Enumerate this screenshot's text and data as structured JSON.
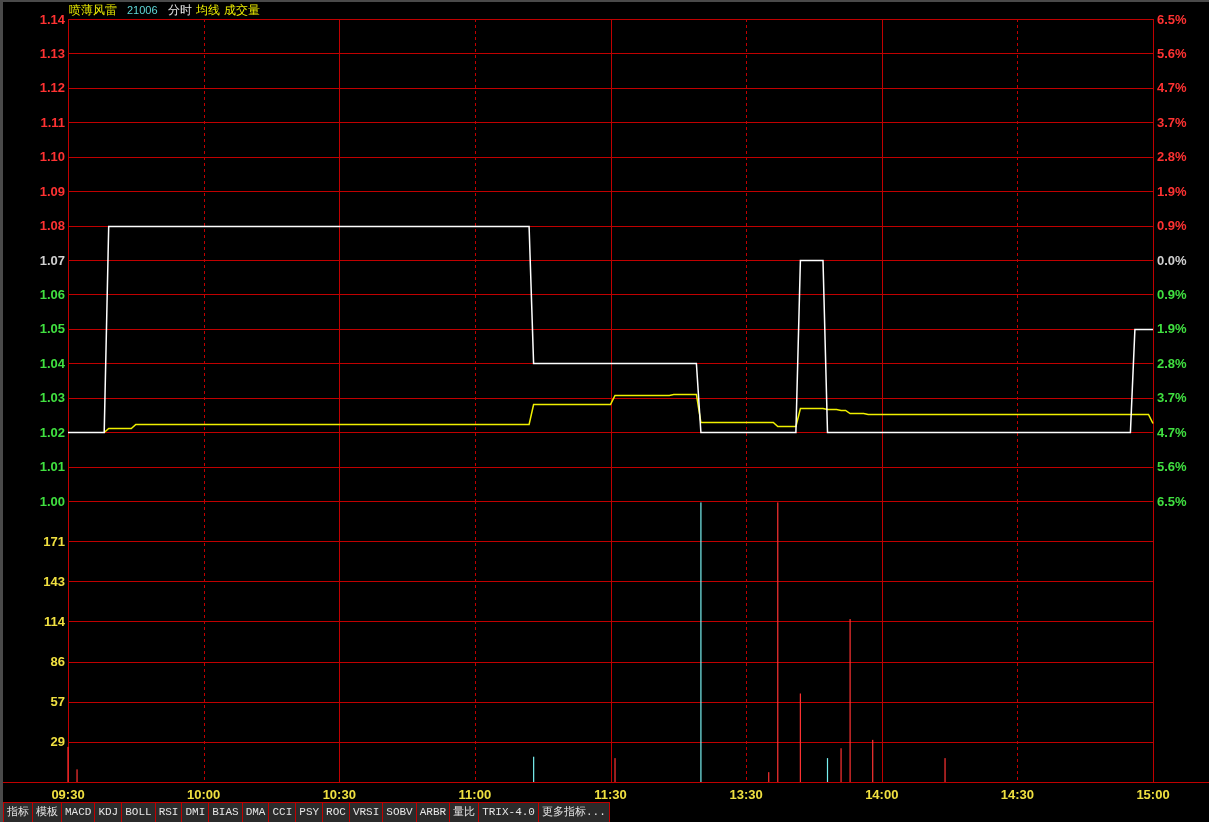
{
  "header": {
    "title": "喷薄风雷",
    "code": "21006",
    "items": [
      {
        "label": "分时",
        "kind": "mode"
      },
      {
        "label": "均线",
        "kind": "indicator"
      },
      {
        "label": "成交量",
        "kind": "indicator"
      }
    ]
  },
  "price_chart": {
    "chart_data": {
      "type": "line",
      "grid": true,
      "categories": [
        null,
        null,
        null,
        null,
        null,
        null,
        null,
        null,
        null,
        null,
        null,
        null,
        null,
        null,
        null,
        null,
        null,
        null,
        null,
        null,
        null,
        null,
        null,
        null,
        null,
        null,
        null,
        null,
        null,
        null,
        null,
        null,
        null,
        null,
        null,
        null,
        null,
        null,
        null,
        null,
        null,
        null,
        null,
        null,
        null,
        null,
        null,
        null,
        null,
        null,
        null,
        null,
        null,
        null,
        null,
        null,
        null,
        null,
        null,
        null,
        null,
        null,
        null,
        null,
        null,
        null,
        null,
        null,
        null,
        null,
        null,
        null,
        null,
        null,
        null,
        null,
        null,
        null,
        null,
        null,
        null,
        null,
        null,
        null,
        null,
        null,
        null,
        null,
        null,
        null,
        null,
        null,
        null,
        null,
        null,
        null,
        null,
        null,
        null,
        null,
        null,
        null,
        null,
        null,
        null,
        null,
        null,
        null,
        null,
        null,
        null,
        null,
        null,
        null,
        null,
        null,
        null,
        null,
        null,
        null,
        null,
        null,
        null,
        null,
        null,
        null,
        null,
        null,
        null,
        null,
        null,
        null,
        null,
        null,
        null,
        null,
        null,
        null,
        null,
        null,
        null,
        null,
        null,
        null,
        null,
        null,
        null,
        null,
        null,
        null,
        null,
        null,
        null,
        null,
        null,
        null,
        null,
        null,
        null,
        null,
        null,
        null,
        null,
        null,
        null,
        null,
        null,
        null,
        null,
        null,
        null,
        null,
        null,
        null,
        null,
        null,
        null,
        null,
        null,
        null,
        null,
        null,
        null,
        null,
        null,
        null,
        null,
        null,
        null,
        null,
        null,
        null,
        null,
        null,
        null,
        null,
        null,
        null,
        null,
        null,
        null,
        null,
        null,
        null,
        null,
        null,
        null,
        null,
        null,
        null,
        null,
        null,
        null,
        null,
        null,
        null,
        null,
        null,
        null,
        null,
        null,
        null,
        null,
        null,
        null,
        null,
        null,
        null,
        null,
        null,
        null,
        null,
        null,
        null,
        null,
        null,
        null,
        null,
        null,
        null,
        null
      ],
      "ylim": [
        1.0,
        1.14
      ],
      "yticks": [
        {
          "value": 1.14,
          "label": "1.14"
        },
        {
          "value": 1.13,
          "label": "1.13"
        },
        {
          "value": 1.12,
          "label": "1.12"
        },
        {
          "value": 1.11,
          "label": "1.11"
        },
        {
          "value": 1.1,
          "label": "1.10"
        },
        {
          "value": 1.09,
          "label": "1.09"
        },
        {
          "value": 1.08,
          "label": "1.08"
        },
        {
          "value": 1.07,
          "label": "1.07"
        },
        {
          "value": 1.06,
          "label": "1.06"
        },
        {
          "value": 1.05,
          "label": "1.05"
        },
        {
          "value": 1.04,
          "label": "1.04"
        },
        {
          "value": 1.03,
          "label": "1.03"
        },
        {
          "value": 1.02,
          "label": "1.02"
        },
        {
          "value": 1.01,
          "label": "1.01"
        },
        {
          "value": 1.0,
          "label": "1.00"
        }
      ],
      "series": [
        {
          "color": "#ffffff",
          "values": [
            1.02,
            1.02,
            1.02,
            1.02,
            1.02,
            1.02,
            1.02,
            1.02,
            1.02,
            1.08,
            1.08,
            1.08,
            1.08,
            1.08,
            1.08,
            1.08,
            1.08,
            1.08,
            1.08,
            1.08,
            1.08,
            1.08,
            1.08,
            1.08,
            1.08,
            1.08,
            1.08,
            1.08,
            1.08,
            1.08,
            1.08,
            1.08,
            1.08,
            1.08,
            1.08,
            1.08,
            1.08,
            1.08,
            1.08,
            1.08,
            1.08,
            1.08,
            1.08,
            1.08,
            1.08,
            1.08,
            1.08,
            1.08,
            1.08,
            1.08,
            1.08,
            1.08,
            1.08,
            1.08,
            1.08,
            1.08,
            1.08,
            1.08,
            1.08,
            1.08,
            1.08,
            1.08,
            1.08,
            1.08,
            1.08,
            1.08,
            1.08,
            1.08,
            1.08,
            1.08,
            1.08,
            1.08,
            1.08,
            1.08,
            1.08,
            1.08,
            1.08,
            1.08,
            1.08,
            1.08,
            1.08,
            1.08,
            1.08,
            1.08,
            1.08,
            1.08,
            1.08,
            1.08,
            1.08,
            1.08,
            1.08,
            1.08,
            1.08,
            1.08,
            1.08,
            1.08,
            1.08,
            1.08,
            1.08,
            1.08,
            1.08,
            1.08,
            1.08,
            1.04,
            1.04,
            1.04,
            1.04,
            1.04,
            1.04,
            1.04,
            1.04,
            1.04,
            1.04,
            1.04,
            1.04,
            1.04,
            1.04,
            1.04,
            1.04,
            1.04,
            1.04,
            1.04,
            1.04,
            1.04,
            1.04,
            1.04,
            1.04,
            1.04,
            1.04,
            1.04,
            1.04,
            1.04,
            1.04,
            1.04,
            1.04,
            1.04,
            1.04,
            1.04,
            1.04,
            1.04,
            1.02,
            1.02,
            1.02,
            1.02,
            1.02,
            1.02,
            1.02,
            1.02,
            1.02,
            1.02,
            1.02,
            1.02,
            1.02,
            1.02,
            1.02,
            1.02,
            1.02,
            1.02,
            1.02,
            1.02,
            1.02,
            1.02,
            1.07,
            1.07,
            1.07,
            1.07,
            1.07,
            1.07,
            1.02,
            1.02,
            1.02,
            1.02,
            1.02,
            1.02,
            1.02,
            1.02,
            1.02,
            1.02,
            1.02,
            1.02,
            1.02,
            1.02,
            1.02,
            1.02,
            1.02,
            1.02,
            1.02,
            1.02,
            1.02,
            1.02,
            1.02,
            1.02,
            1.02,
            1.02,
            1.02,
            1.02,
            1.02,
            1.02,
            1.02,
            1.02,
            1.02,
            1.02,
            1.02,
            1.02,
            1.02,
            1.02,
            1.02,
            1.02,
            1.02,
            1.02,
            1.02,
            1.02,
            1.02,
            1.02,
            1.02,
            1.02,
            1.02,
            1.02,
            1.02,
            1.02,
            1.02,
            1.02,
            1.02,
            1.02,
            1.02,
            1.02,
            1.02,
            1.02,
            1.02,
            1.02,
            1.02,
            1.02,
            1.02,
            1.02,
            1.02,
            1.02,
            1.05,
            1.05,
            1.05,
            1.05,
            1.05
          ]
        },
        {
          "color": "#f0f000",
          "values": [
            null,
            null,
            null,
            null,
            null,
            null,
            null,
            null,
            1.02,
            1.0212,
            1.0212,
            1.0212,
            1.0212,
            1.0212,
            1.0212,
            1.0223,
            1.0223,
            1.0223,
            1.0223,
            1.0223,
            1.0223,
            1.0223,
            1.0223,
            1.0223,
            1.0223,
            1.0223,
            1.0223,
            1.0223,
            1.0223,
            1.0223,
            1.0223,
            1.0223,
            1.0223,
            1.0223,
            1.0223,
            1.0223,
            1.0223,
            1.0223,
            1.0223,
            1.0223,
            1.0223,
            1.0223,
            1.0223,
            1.0223,
            1.0223,
            1.0223,
            1.0223,
            1.0223,
            1.0223,
            1.0223,
            1.0223,
            1.0223,
            1.0223,
            1.0223,
            1.0223,
            1.0223,
            1.0223,
            1.0223,
            1.0223,
            1.0223,
            1.0223,
            1.0223,
            1.0223,
            1.0223,
            1.0223,
            1.0223,
            1.0223,
            1.0223,
            1.0223,
            1.0223,
            1.0223,
            1.0223,
            1.0223,
            1.0223,
            1.0223,
            1.0223,
            1.0223,
            1.0223,
            1.0223,
            1.0223,
            1.0223,
            1.0223,
            1.0223,
            1.0223,
            1.0223,
            1.0223,
            1.0223,
            1.0223,
            1.0223,
            1.0223,
            1.0223,
            1.0223,
            1.0223,
            1.0223,
            1.0223,
            1.0223,
            1.0223,
            1.0223,
            1.0223,
            1.0223,
            1.0223,
            1.0223,
            1.0223,
            1.0283,
            1.0283,
            1.0283,
            1.0283,
            1.0283,
            1.0283,
            1.0283,
            1.0283,
            1.0283,
            1.0283,
            1.0283,
            1.0283,
            1.0283,
            1.0283,
            1.0283,
            1.0283,
            1.0283,
            1.0283,
            1.0309,
            1.0309,
            1.0309,
            1.0309,
            1.0309,
            1.0309,
            1.0309,
            1.0309,
            1.0309,
            1.0309,
            1.0309,
            1.0309,
            1.0309,
            1.0312,
            1.0312,
            1.0312,
            1.0312,
            1.0312,
            1.0312,
            1.0229,
            1.0229,
            1.0229,
            1.0229,
            1.0229,
            1.0229,
            1.0229,
            1.0229,
            1.0229,
            1.0229,
            1.0229,
            1.0229,
            1.0229,
            1.0229,
            1.0229,
            1.0229,
            1.0229,
            1.0217,
            1.0217,
            1.0217,
            1.0217,
            1.0217,
            1.027,
            1.027,
            1.027,
            1.027,
            1.027,
            1.027,
            1.0267,
            1.0267,
            1.0267,
            1.0265,
            1.0265,
            1.0255,
            1.0255,
            1.0255,
            1.0255,
            1.0253,
            1.0253,
            1.0253,
            1.0253,
            1.0253,
            1.0253,
            1.0253,
            1.0253,
            1.0253,
            1.0253,
            1.0253,
            1.0253,
            1.0253,
            1.0253,
            1.0253,
            1.0253,
            1.0253,
            1.0253,
            1.0253,
            1.0253,
            1.0253,
            1.0253,
            1.0253,
            1.0253,
            1.0253,
            1.0253,
            1.0253,
            1.0253,
            1.0253,
            1.0253,
            1.0253,
            1.0253,
            1.0253,
            1.0253,
            1.0253,
            1.0253,
            1.0253,
            1.0253,
            1.0253,
            1.0253,
            1.0253,
            1.0253,
            1.0253,
            1.0253,
            1.0253,
            1.0253,
            1.0253,
            1.0253,
            1.0253,
            1.0253,
            1.0253,
            1.0253,
            1.0253,
            1.0253,
            1.0253,
            1.0253,
            1.0253,
            1.0253,
            1.0253,
            1.0253,
            1.0253,
            1.0253,
            1.0253,
            1.0228
          ]
        }
      ]
    },
    "left_axis": [
      {
        "color": "#ff3232"
      },
      {
        "color": "#ff3232"
      },
      {
        "color": "#ff3232"
      },
      {
        "color": "#ff3232"
      },
      {
        "color": "#ff3232"
      },
      {
        "color": "#ff3232"
      },
      {
        "color": "#ff3232"
      },
      {
        "color": "#d0d0d0"
      },
      {
        "color": "#40e040"
      },
      {
        "color": "#40e040"
      },
      {
        "color": "#40e040"
      },
      {
        "color": "#40e040"
      },
      {
        "color": "#40e040"
      },
      {
        "color": "#40e040"
      },
      {
        "color": "#40e040"
      }
    ],
    "right_axis": [
      {
        "label": "6.5%",
        "color": "#ff3232"
      },
      {
        "label": "5.6%",
        "color": "#ff3232"
      },
      {
        "label": "4.7%",
        "color": "#ff3232"
      },
      {
        "label": "3.7%",
        "color": "#ff3232"
      },
      {
        "label": "2.8%",
        "color": "#ff3232"
      },
      {
        "label": "1.9%",
        "color": "#ff3232"
      },
      {
        "label": "0.9%",
        "color": "#ff3232"
      },
      {
        "label": "0.0%",
        "color": "#d0d0d0"
      },
      {
        "label": "0.9%",
        "color": "#40e040"
      },
      {
        "label": "1.9%",
        "color": "#40e040"
      },
      {
        "label": "2.8%",
        "color": "#40e040"
      },
      {
        "label": "3.7%",
        "color": "#40e040"
      },
      {
        "label": "4.7%",
        "color": "#40e040"
      },
      {
        "label": "5.6%",
        "color": "#40e040"
      },
      {
        "label": "6.5%",
        "color": "#40e040"
      }
    ]
  },
  "volume_chart": {
    "chart_data": {
      "type": "bar",
      "grid": true,
      "categories": [
        "09:30",
        null,
        null,
        null,
        null,
        null,
        null,
        null,
        null,
        null,
        null,
        null,
        null,
        null,
        null,
        null,
        null,
        null,
        null,
        null,
        null,
        null,
        null,
        null,
        null,
        null,
        null,
        null,
        null,
        null,
        "10:00",
        null,
        null,
        null,
        null,
        null,
        null,
        null,
        null,
        null,
        null,
        null,
        null,
        null,
        null,
        null,
        null,
        null,
        null,
        null,
        null,
        null,
        null,
        null,
        null,
        null,
        null,
        null,
        null,
        null,
        "10:30",
        null,
        null,
        null,
        null,
        null,
        null,
        null,
        null,
        null,
        null,
        null,
        null,
        null,
        null,
        null,
        null,
        null,
        null,
        null,
        null,
        null,
        null,
        null,
        null,
        null,
        null,
        null,
        null,
        null,
        "11:00",
        null,
        null,
        null,
        null,
        null,
        null,
        null,
        null,
        null,
        null,
        null,
        null,
        null,
        null,
        null,
        null,
        null,
        null,
        null,
        null,
        null,
        null,
        null,
        null,
        null,
        null,
        null,
        null,
        null,
        "11:30",
        null,
        null,
        null,
        null,
        null,
        null,
        null,
        null,
        null,
        null,
        null,
        null,
        null,
        null,
        null,
        null,
        null,
        null,
        null,
        null,
        null,
        null,
        null,
        null,
        null,
        null,
        null,
        null,
        null,
        "13:30",
        null,
        null,
        null,
        null,
        null,
        null,
        null,
        null,
        null,
        null,
        null,
        null,
        null,
        null,
        null,
        null,
        null,
        null,
        null,
        null,
        null,
        null,
        null,
        null,
        null,
        null,
        null,
        null,
        null,
        "14:00",
        null,
        null,
        null,
        null,
        null,
        null,
        null,
        null,
        null,
        null,
        null,
        null,
        null,
        null,
        null,
        null,
        null,
        null,
        null,
        null,
        null,
        null,
        null,
        null,
        null,
        null,
        null,
        null,
        null,
        "14:30",
        null,
        null,
        null,
        null,
        null,
        null,
        null,
        null,
        null,
        null,
        null,
        null,
        null,
        null,
        null,
        null,
        null,
        null,
        null,
        null,
        null,
        null,
        null,
        null,
        null,
        null,
        null,
        null,
        null,
        "15:00"
      ],
      "ylim": [
        0,
        200
      ],
      "yticks": [
        {
          "value": 171.43,
          "label": "171"
        },
        {
          "value": 142.86,
          "label": "143"
        },
        {
          "value": 114.29,
          "label": "114"
        },
        {
          "value": 85.71,
          "label": "86"
        },
        {
          "value": 57.14,
          "label": "57"
        },
        {
          "value": 28.57,
          "label": "29"
        }
      ],
      "series": [
        {
          "color": "#ff3232",
          "values": [
            25,
            null,
            9,
            null,
            null,
            null,
            null,
            null,
            null,
            null,
            null,
            null,
            null,
            null,
            null,
            null,
            null,
            null,
            null,
            null,
            null,
            null,
            null,
            null,
            null,
            null,
            null,
            null,
            null,
            null,
            null,
            null,
            null,
            null,
            null,
            null,
            null,
            null,
            null,
            null,
            null,
            null,
            null,
            null,
            null,
            null,
            null,
            null,
            null,
            null,
            null,
            null,
            null,
            null,
            null,
            null,
            null,
            null,
            null,
            null,
            null,
            null,
            null,
            null,
            null,
            null,
            null,
            null,
            null,
            null,
            null,
            null,
            null,
            null,
            null,
            null,
            null,
            null,
            null,
            null,
            null,
            null,
            null,
            null,
            null,
            null,
            null,
            null,
            null,
            null,
            null,
            null,
            null,
            null,
            null,
            null,
            null,
            null,
            null,
            null,
            null,
            null,
            null,
            null,
            null,
            null,
            null,
            null,
            null,
            null,
            null,
            null,
            null,
            null,
            null,
            null,
            null,
            null,
            null,
            null,
            null,
            17,
            null,
            null,
            null,
            null,
            null,
            null,
            null,
            null,
            null,
            null,
            null,
            null,
            null,
            null,
            null,
            null,
            null,
            null,
            null,
            null,
            null,
            null,
            null,
            null,
            null,
            null,
            null,
            null,
            null,
            null,
            null,
            null,
            null,
            7,
            null,
            199,
            null,
            null,
            null,
            null,
            63,
            null,
            null,
            null,
            null,
            null,
            null,
            null,
            null,
            24,
            null,
            116,
            null,
            null,
            null,
            null,
            30,
            null,
            null,
            null,
            null,
            null,
            null,
            null,
            null,
            null,
            null,
            null,
            null,
            null,
            null,
            null,
            17,
            null,
            null,
            null,
            null,
            null,
            null,
            null,
            null,
            null,
            null,
            null,
            null,
            null,
            null,
            null,
            null,
            null,
            null,
            null,
            null,
            null,
            null,
            null,
            null,
            null,
            null,
            null,
            null,
            null,
            null,
            null,
            null,
            null,
            null,
            null,
            null,
            null,
            null,
            null,
            null,
            null,
            null,
            null,
            null,
            null,
            null
          ]
        },
        {
          "color": "#78f0f0",
          "values": [
            null,
            null,
            null,
            null,
            null,
            null,
            null,
            null,
            null,
            null,
            null,
            null,
            null,
            null,
            null,
            null,
            null,
            null,
            null,
            null,
            null,
            null,
            null,
            null,
            null,
            null,
            null,
            null,
            null,
            null,
            null,
            null,
            null,
            null,
            null,
            null,
            null,
            null,
            null,
            null,
            null,
            null,
            null,
            null,
            null,
            null,
            null,
            null,
            null,
            null,
            null,
            null,
            null,
            null,
            null,
            null,
            null,
            null,
            null,
            null,
            null,
            null,
            null,
            null,
            null,
            null,
            null,
            null,
            null,
            null,
            null,
            null,
            null,
            null,
            null,
            null,
            null,
            null,
            null,
            null,
            null,
            null,
            null,
            null,
            null,
            null,
            null,
            null,
            null,
            null,
            null,
            null,
            null,
            null,
            null,
            null,
            null,
            null,
            null,
            null,
            null,
            null,
            null,
            18,
            null,
            null,
            null,
            null,
            null,
            null,
            null,
            null,
            null,
            null,
            null,
            null,
            null,
            null,
            null,
            null,
            null,
            null,
            null,
            null,
            null,
            null,
            null,
            null,
            null,
            null,
            null,
            null,
            null,
            null,
            null,
            null,
            null,
            null,
            null,
            null,
            199,
            null,
            null,
            null,
            null,
            null,
            null,
            null,
            null,
            null,
            null,
            null,
            null,
            null,
            null,
            null,
            null,
            null,
            null,
            null,
            null,
            null,
            null,
            null,
            null,
            null,
            null,
            null,
            17,
            null,
            null,
            null,
            null,
            null,
            null,
            null,
            null,
            null,
            null,
            null,
            null,
            null,
            null,
            null,
            null,
            null,
            null,
            null,
            null,
            null,
            null,
            null,
            null,
            null,
            null,
            null,
            null,
            null,
            null,
            null,
            null,
            null,
            null,
            null,
            null,
            null,
            null,
            null,
            null,
            null,
            null,
            null,
            null,
            null,
            null,
            null,
            null,
            null,
            null,
            null,
            null,
            null,
            null,
            null,
            null,
            null,
            null,
            null,
            null,
            null,
            null,
            null,
            null,
            null,
            null,
            null,
            null,
            null,
            null,
            null,
            null
          ]
        }
      ]
    }
  },
  "indicator_tabs": [
    "指标",
    "模板",
    "MACD",
    "KDJ",
    "BOLL",
    "RSI",
    "DMI",
    "BIAS",
    "DMA",
    "CCI",
    "PSY",
    "ROC",
    "VRSI",
    "SOBV",
    "ARBR",
    "量比",
    "TRIX-4.0",
    "更多指标..."
  ]
}
